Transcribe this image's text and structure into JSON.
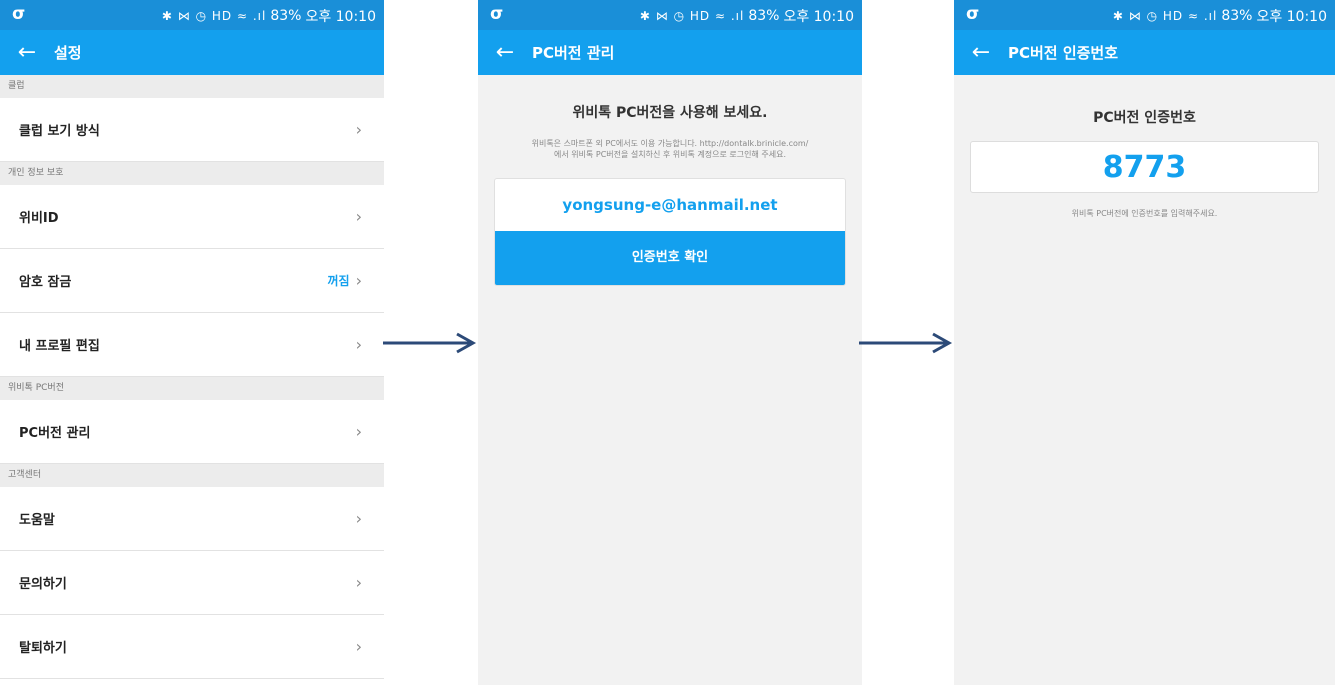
{
  "status": {
    "logo": "σ",
    "icons": "✱ ⋈ ◷ HD ≈ .ıl",
    "battery": "83%",
    "time": "오후 10:10"
  },
  "screen1": {
    "title": "설정",
    "sections": [
      {
        "header": "클럽",
        "rows": [
          {
            "label": "클럽 보기 방식",
            "value": ""
          }
        ]
      },
      {
        "header": "개인 정보 보호",
        "rows": [
          {
            "label": "위비ID",
            "value": ""
          },
          {
            "label": "암호 잠금",
            "value": "꺼짐"
          },
          {
            "label": "내 프로필 편집",
            "value": ""
          }
        ]
      },
      {
        "header": "위비톡 PC버전",
        "rows": [
          {
            "label": "PC버전 관리",
            "value": ""
          }
        ]
      },
      {
        "header": "고객센터",
        "rows": [
          {
            "label": "도움말",
            "value": ""
          },
          {
            "label": "문의하기",
            "value": ""
          },
          {
            "label": "탈퇴하기",
            "value": ""
          }
        ]
      }
    ]
  },
  "screen2": {
    "title": "PC버전 관리",
    "heading": "위비톡 PC버전을 사용해 보세요.",
    "desc_line1": "위비톡은 스마트폰 외 PC에서도 이용 가능합니다. http://dontalk.brinicle.com/",
    "desc_line2": "에서 위비톡 PC버전을 설치하신 후 위비톡 계정으로 로그인해 주세요.",
    "email": "yongsung-e@hanmail.net",
    "button": "인증번호 확인"
  },
  "screen3": {
    "title": "PC버전 인증번호",
    "heading": "PC버전 인증번호",
    "code": "8773",
    "desc": "위비톡 PC버전에 인증번호를 입력해주세요."
  },
  "colors": {
    "accent": "#13a0ee",
    "statusbar": "#1a8fd8",
    "arrow": "#2c4a78"
  }
}
